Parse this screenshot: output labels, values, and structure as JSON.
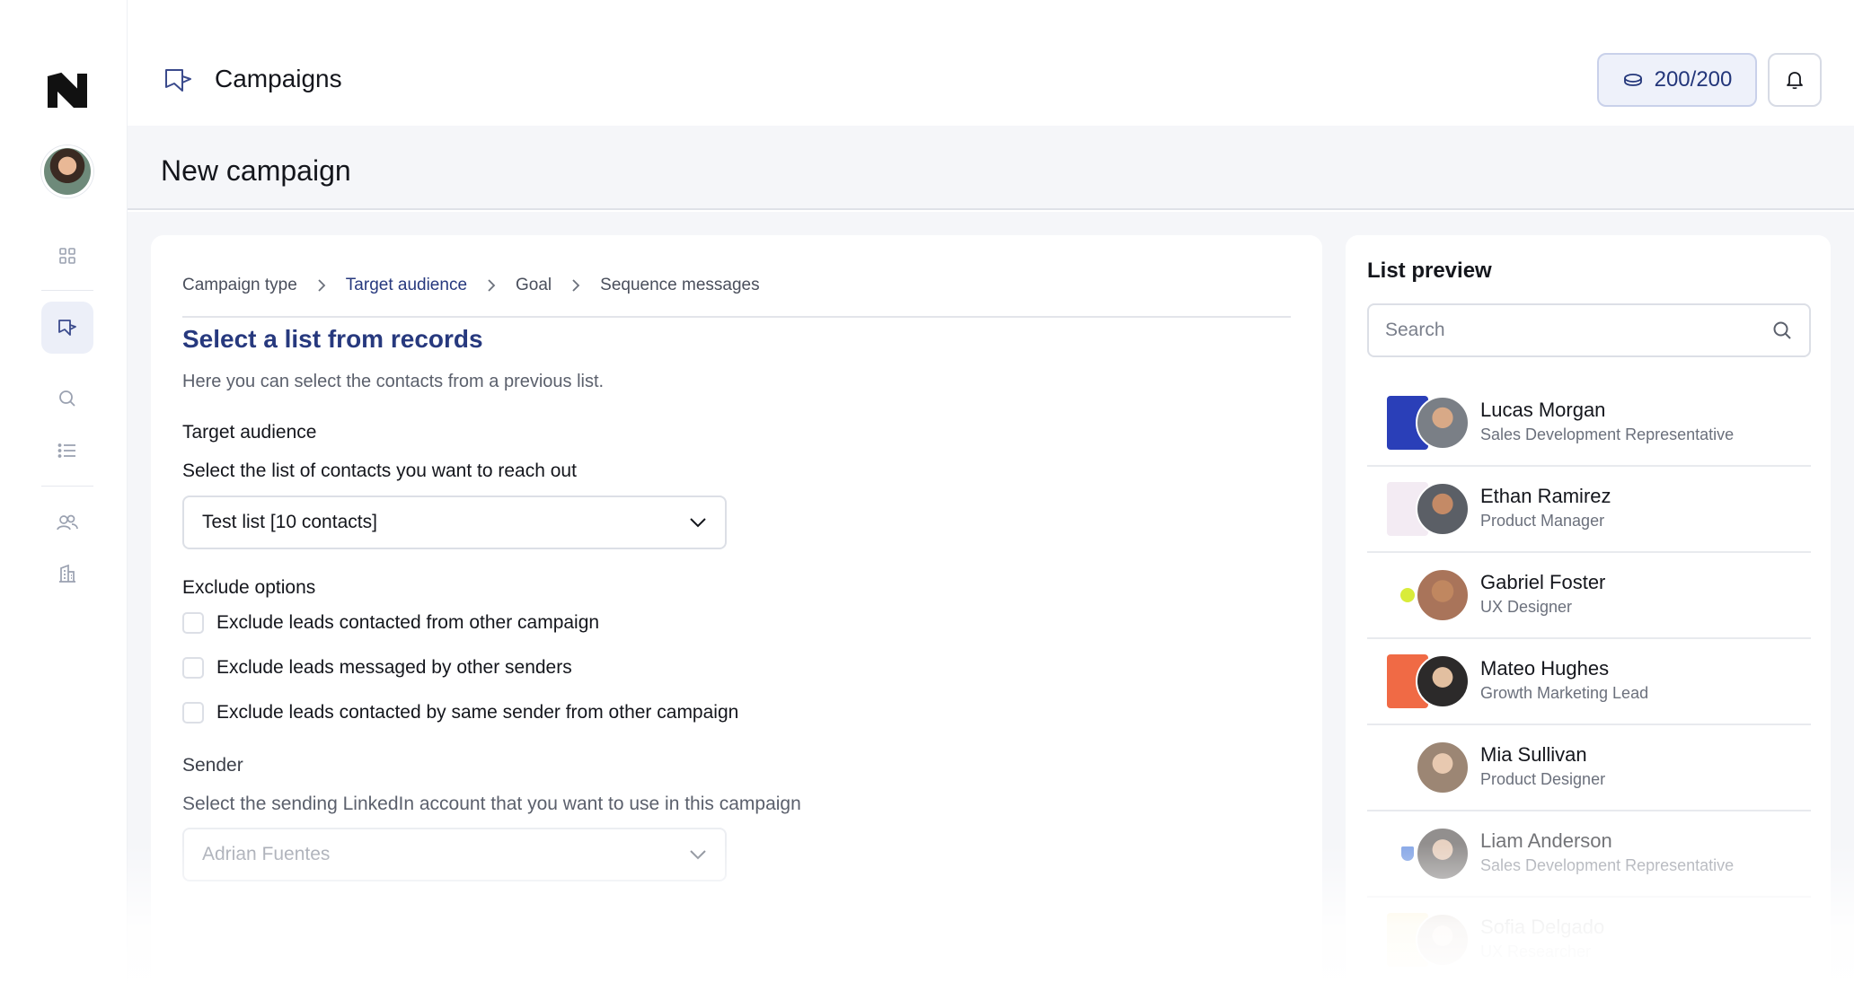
{
  "header": {
    "title": "Campaigns",
    "credits": "200/200"
  },
  "page": {
    "title": "New campaign"
  },
  "steps": [
    "Campaign type",
    "Target audience",
    "Goal",
    "Sequence messages"
  ],
  "form": {
    "section_title": "Select a list from records",
    "section_sub": "Here you can select the contacts from a previous list.",
    "target_label": "Target audience",
    "target_help": "Select the list of contacts you want to reach out",
    "target_value": "Test list [10 contacts]",
    "exclude_label": "Exclude options",
    "exclude": [
      "Exclude leads contacted from other campaign",
      "Exclude leads messaged by other senders",
      "Exclude leads contacted by same sender from other campaign"
    ],
    "sender_label": "Sender",
    "sender_help": "Select the sending LinkedIn account that you want to use in this campaign",
    "sender_value": "Adrian Fuentes"
  },
  "preview": {
    "title": "List preview",
    "search_placeholder": "Search",
    "contacts": [
      {
        "name": "Lucas Morgan",
        "role": "Sales Development Representative"
      },
      {
        "name": "Ethan Ramirez",
        "role": "Product Manager"
      },
      {
        "name": "Gabriel Foster",
        "role": "UX Designer"
      },
      {
        "name": "Mateo Hughes",
        "role": "Growth Marketing Lead"
      },
      {
        "name": "Mia Sullivan",
        "role": "Product Designer"
      },
      {
        "name": "Liam Anderson",
        "role": "Sales Development Representative"
      },
      {
        "name": "Sofia Delgado",
        "role": "UX Researcher"
      }
    ]
  },
  "colors": {
    "accent": "#27397e",
    "muted": "#5b606c",
    "page_bg": "#f5f6f9"
  }
}
